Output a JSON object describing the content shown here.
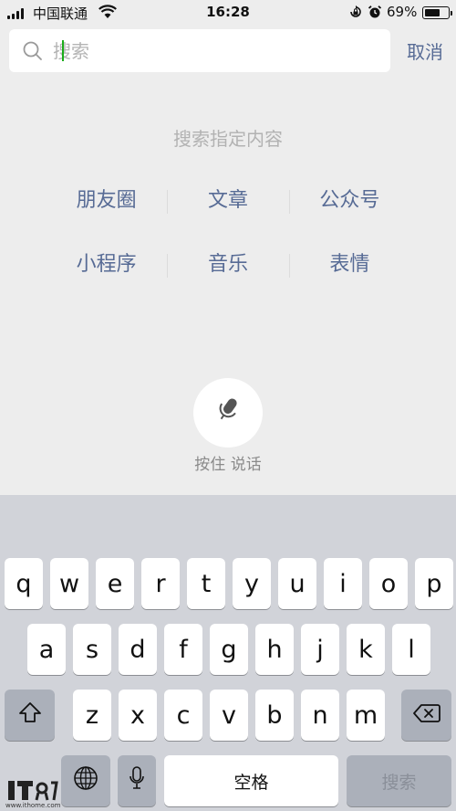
{
  "status_bar": {
    "carrier": "中国联通",
    "time": "16:28",
    "battery_percent": "69%",
    "battery_level": 0.69,
    "icons": [
      "signal-icon",
      "wifi-icon",
      "orientation-lock-icon",
      "alarm-icon",
      "battery-icon"
    ]
  },
  "search": {
    "placeholder": "搜索",
    "value": "",
    "cancel_label": "取消"
  },
  "hints": {
    "title": "搜索指定内容",
    "row1": [
      "朋友圈",
      "文章",
      "公众号"
    ],
    "row2": [
      "小程序",
      "音乐",
      "表情"
    ]
  },
  "voice": {
    "label": "按住 说话",
    "icon": "microphone-icon"
  },
  "keyboard": {
    "row1": [
      "q",
      "w",
      "e",
      "r",
      "t",
      "y",
      "u",
      "i",
      "o",
      "p"
    ],
    "row2": [
      "a",
      "s",
      "d",
      "f",
      "g",
      "h",
      "j",
      "k",
      "l"
    ],
    "row3": [
      "z",
      "x",
      "c",
      "v",
      "b",
      "n",
      "m"
    ],
    "space_label": "空格",
    "search_label": "搜索",
    "icons": [
      "shift-icon",
      "backspace-icon",
      "globe-icon",
      "microphone-icon"
    ]
  },
  "watermark": {
    "text": "www.ithome.com"
  },
  "colors": {
    "link": "#576b95",
    "background": "#ededed",
    "keyboard_bg": "#d1d3d9",
    "dark_key": "#abb0ba"
  }
}
